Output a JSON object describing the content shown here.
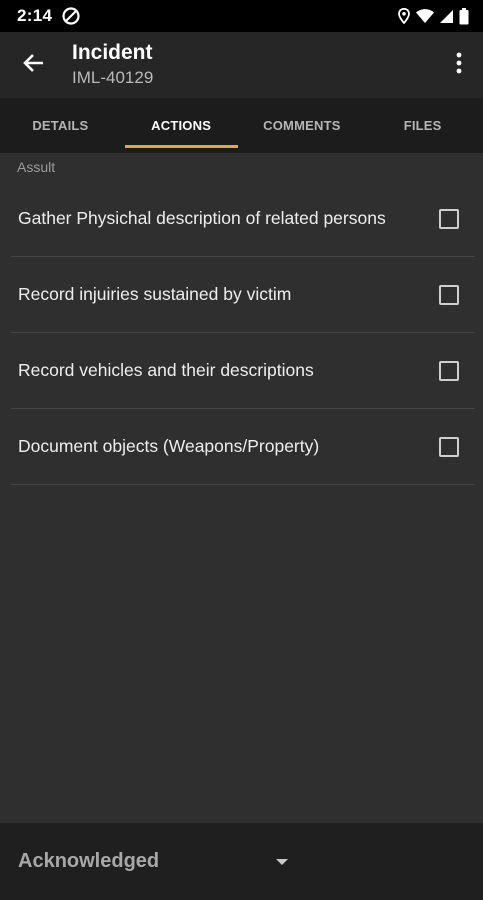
{
  "status_bar": {
    "time": "2:14",
    "icons": [
      "sync-disabled-icon",
      "location-icon",
      "wifi-icon",
      "signal-icon",
      "battery-icon"
    ]
  },
  "app_bar": {
    "title": "Incident",
    "subtitle": "IML-40129",
    "icons": [
      "back-arrow-icon",
      "more-vert-icon"
    ]
  },
  "tabs": [
    {
      "label": "DETAILS",
      "active": false
    },
    {
      "label": "ACTIONS",
      "active": true
    },
    {
      "label": "COMMENTS",
      "active": false
    },
    {
      "label": "FILES",
      "active": false
    }
  ],
  "colors": {
    "accent": "#e3a44a",
    "background": "#2f2f2f",
    "app_bar": "#262626",
    "tab_bar": "#1c1c1c"
  },
  "section": {
    "label": "Assult",
    "actions": [
      {
        "label": "Gather Physichal description of related persons",
        "checked": false
      },
      {
        "label": "Record injuiries sustained by victim",
        "checked": false
      },
      {
        "label": "Record vehicles and their descriptions",
        "checked": false
      },
      {
        "label": "Document objects (Weapons/Property)",
        "checked": false
      }
    ]
  },
  "bottom_bar": {
    "status_value": "Acknowledged"
  }
}
